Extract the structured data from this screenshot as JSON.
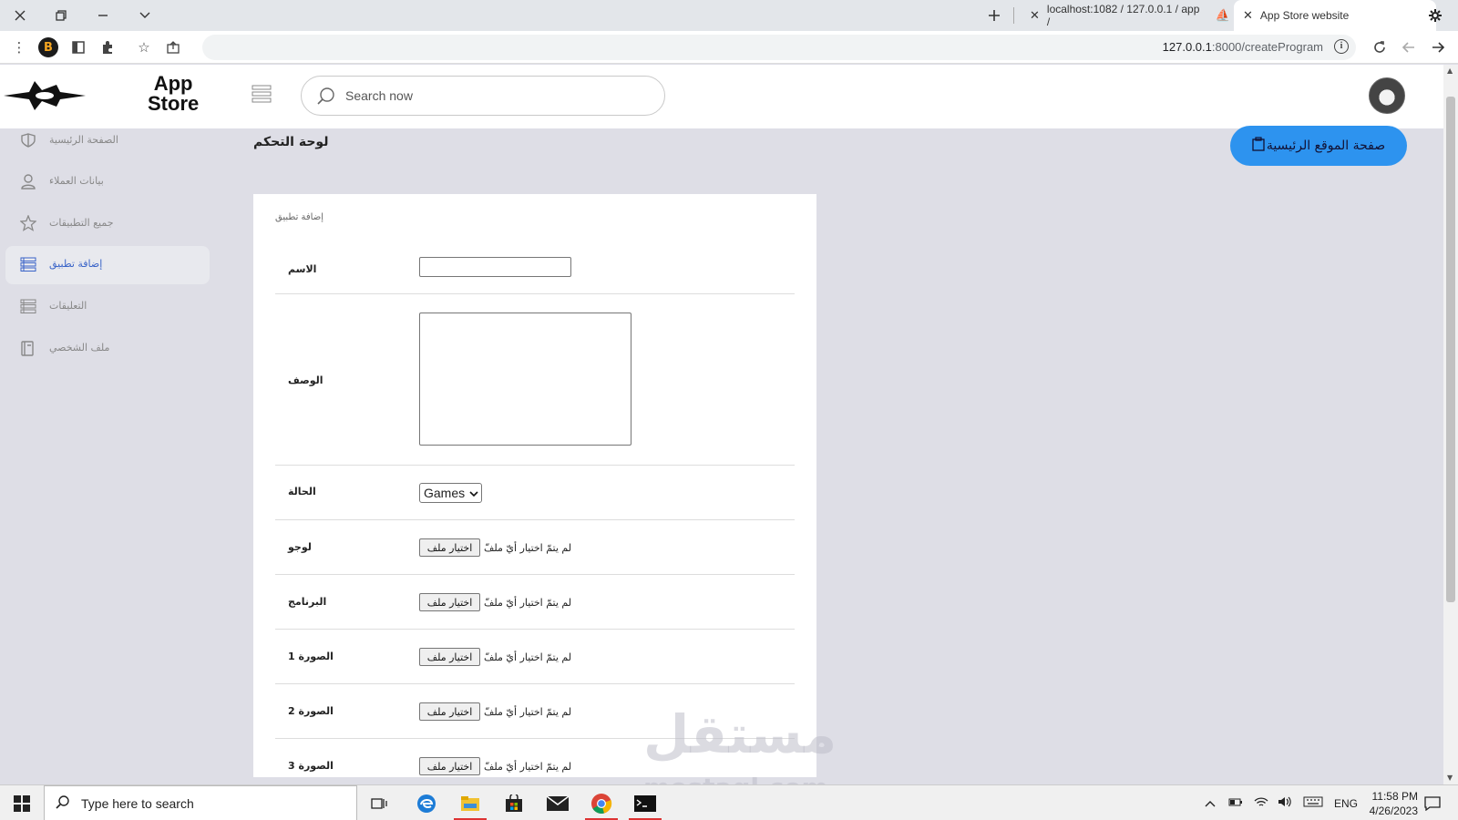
{
  "browser": {
    "tabs": [
      {
        "label": "localhost:1082 / 127.0.0.1 / app /",
        "active": false
      },
      {
        "label": "App Store website",
        "active": true
      }
    ],
    "url_host": "127.0.0.1",
    "url_path": ":8000/createProgram",
    "extension_badge": "B"
  },
  "header": {
    "logo_line1": "App",
    "logo_line2": "Store",
    "search_placeholder": "Search now"
  },
  "sidebar": {
    "items": [
      {
        "label": "الصفحة الرئيسية",
        "icon": "shield-icon",
        "active": false
      },
      {
        "label": "بيانات العملاء",
        "icon": "user-icon",
        "active": false
      },
      {
        "label": "جميع التطبيقات",
        "icon": "star-icon",
        "active": false
      },
      {
        "label": "إضافة تطبيق",
        "icon": "list-icon",
        "active": true
      },
      {
        "label": "التعليقات",
        "icon": "list-icon",
        "active": false
      },
      {
        "label": "ملف الشخصي",
        "icon": "book-icon",
        "active": false
      }
    ]
  },
  "main": {
    "title": "لوحة التحكم",
    "home_button": "صفحة الموقع الرئيسية",
    "form": {
      "title": "إضافة تطبيق",
      "name_label": "الاسم",
      "description_label": "الوصف",
      "status_label": "الحالة",
      "status_value": "Games",
      "logo_label": "لوجو",
      "program_label": "البرنامج",
      "image1_label": "الصورة 1",
      "image2_label": "الصورة 2",
      "image3_label": "الصورة 3",
      "file_button": "اختيار ملف",
      "file_none": "لم يتمّ اختيار أيّ ملفّ"
    }
  },
  "watermark": {
    "arabic": "مستقل",
    "latin": "mostaql.com"
  },
  "taskbar": {
    "search_placeholder": "Type here to search",
    "language": "ENG",
    "time": "11:58 PM",
    "date": "4/26/2023"
  }
}
